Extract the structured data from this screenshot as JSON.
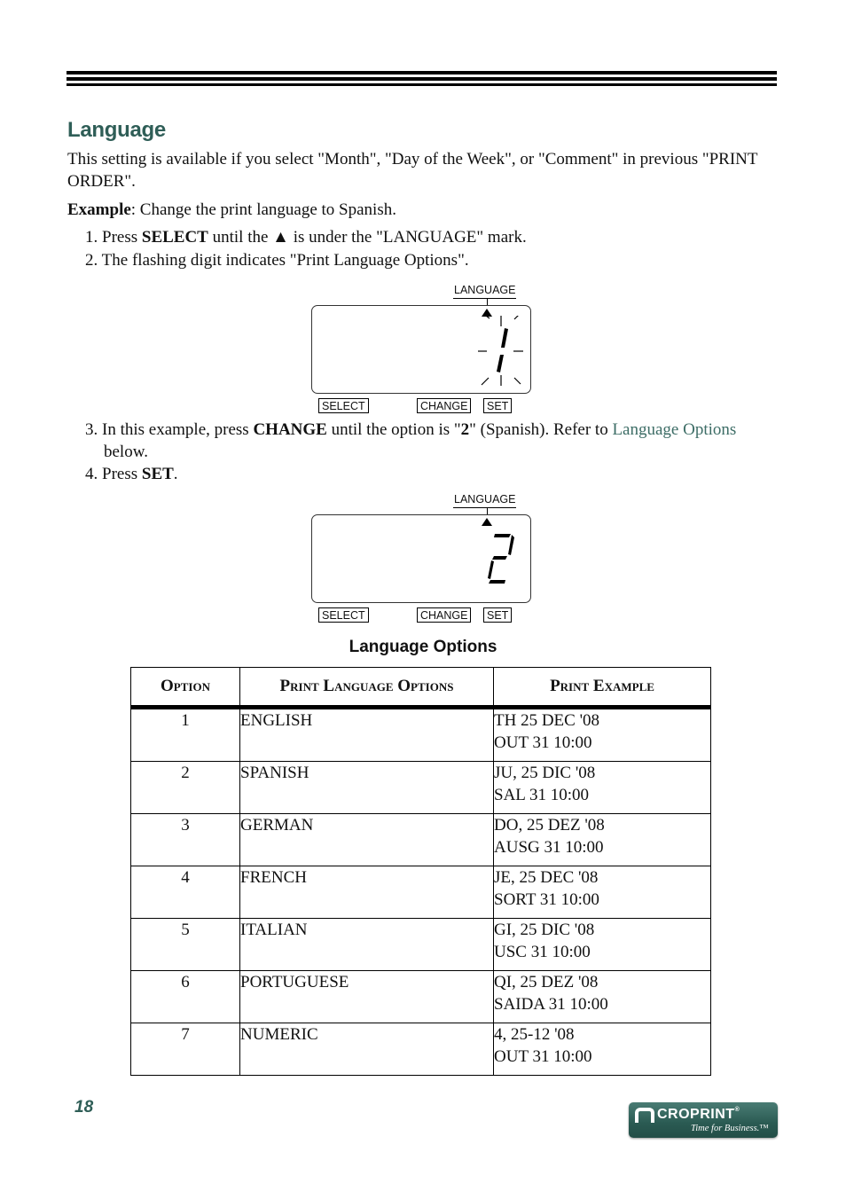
{
  "section": {
    "title": "Language",
    "intro": "This setting is available if you select \"Month\", \"Day of the Week\", or \"Comment\" in previous \"PRINT ORDER\".",
    "example_label": "Example",
    "example_text": ": Change the print language to Spanish."
  },
  "steps": [
    {
      "num": "1.",
      "pre": "Press ",
      "bold": "SELECT",
      "post": " until the ▲ is under the \"LANGUAGE\" mark."
    },
    {
      "num": "2.",
      "text": "The flashing digit indicates \"Print Language Options\"."
    },
    {
      "num": "3.",
      "pre": "In this example, press ",
      "bold": "CHANGE",
      "mid": " until the option is \"",
      "bold2": "2",
      "post": "\" (Spanish). Refer to ",
      "link": "Language Options",
      "cont": "below."
    },
    {
      "num": "4.",
      "pre": "Press ",
      "bold": "SET",
      "post": "."
    }
  ],
  "lcd_diagrams": [
    {
      "label": "LANGUAGE",
      "digit": "1",
      "flashing": true,
      "buttons": [
        "SELECT",
        "CHANGE",
        "SET"
      ]
    },
    {
      "label": "LANGUAGE",
      "digit": "2",
      "flashing": false,
      "buttons": [
        "SELECT",
        "CHANGE",
        "SET"
      ]
    }
  ],
  "table": {
    "caption": "Language Options",
    "headers": [
      "Option",
      "Print Language Options",
      "Print Example"
    ],
    "rows": [
      {
        "option": "1",
        "language": "ENGLISH",
        "example1": "TH 25 DEC '08",
        "example2": "OUT 31 10:00"
      },
      {
        "option": "2",
        "language": "SPANISH",
        "example1": "JU, 25 DIC '08",
        "example2": "SAL 31 10:00"
      },
      {
        "option": "3",
        "language": "GERMAN",
        "example1": "DO, 25 DEZ '08",
        "example2": "AUSG 31 10:00"
      },
      {
        "option": "4",
        "language": "FRENCH",
        "example1": "JE, 25 DEC '08",
        "example2": "SORT 31 10:00"
      },
      {
        "option": "5",
        "language": "ITALIAN",
        "example1": "GI, 25 DIC '08",
        "example2": "USC 31 10:00"
      },
      {
        "option": "6",
        "language": "PORTUGUESE",
        "example1": "QI, 25 DEZ '08",
        "example2": "SAIDA 31 10:00"
      },
      {
        "option": "7",
        "language": "NUMERIC",
        "example1": "4, 25-12 '08",
        "example2": "OUT 31 10:00"
      }
    ]
  },
  "footer": {
    "page_number": "18",
    "logo_text": "CROPRINT",
    "logo_reg": "®",
    "logo_tagline": "Time for Business.™"
  },
  "colors": {
    "heading": "#2f5e57",
    "link": "#3d6d66",
    "logo_bg": "#2a5a52"
  }
}
